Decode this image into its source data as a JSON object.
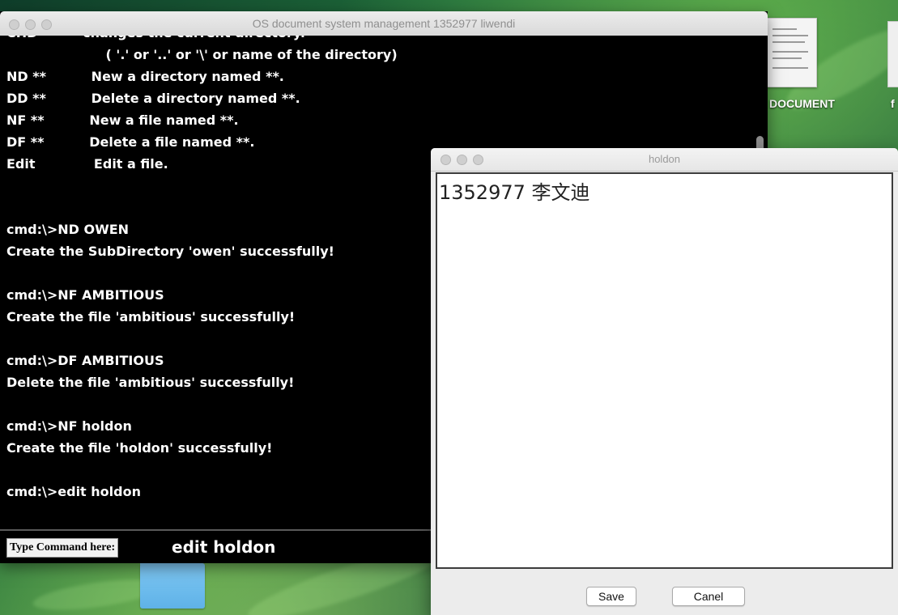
{
  "main_window": {
    "title": "OS document system management 1352977 liwendi",
    "terminal_lines": [
      "CHD          changes the current directory.",
      "                      ( '.' or '..' or '\\' or name of the directory)",
      "ND **          New a directory named **.",
      "DD **          Delete a directory named **.",
      "NF **          New a file named **.",
      "DF **          Delete a file named **.",
      "Edit             Edit a file.",
      "",
      "",
      "cmd:\\>ND OWEN",
      "Create the SubDirectory 'owen' successfully!",
      "",
      "cmd:\\>NF AMBITIOUS",
      "Create the file 'ambitious' successfully!",
      "",
      "cmd:\\>DF AMBITIOUS",
      "Delete the file 'ambitious' successfully!",
      "",
      "cmd:\\>NF holdon",
      "Create the file 'holdon' successfully!",
      "",
      "cmd:\\>edit holdon"
    ],
    "command_label": "Type Command here:",
    "command_value": "edit holdon"
  },
  "edit_window": {
    "title": "holdon",
    "content": "1352977 李文迪",
    "save_label": "Save",
    "cancel_label": "Canel"
  },
  "desktop": {
    "icon_label": "DOCUMENT",
    "icon_label_2": "f"
  }
}
